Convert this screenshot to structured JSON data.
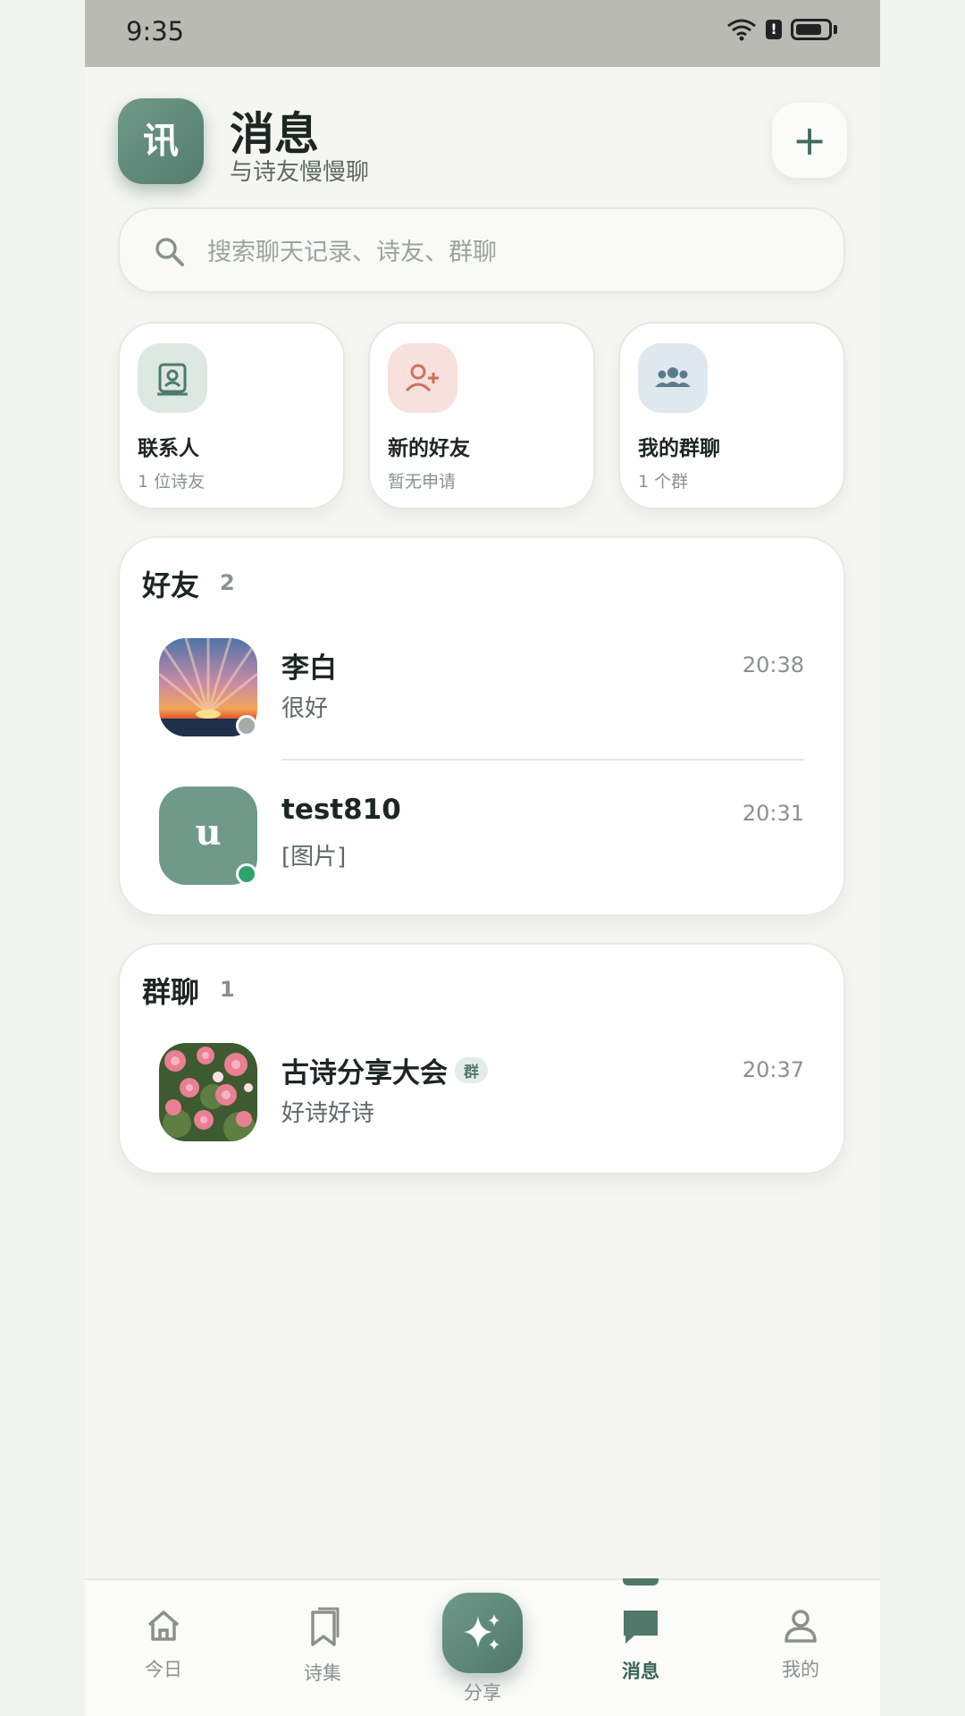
{
  "status_bar": {
    "time": "9:35"
  },
  "header": {
    "logo_text": "讯",
    "title": "消息",
    "subtitle": "与诗友慢慢聊",
    "add_symbol": "+"
  },
  "search": {
    "placeholder": "搜索聊天记录、诗友、群聊"
  },
  "quick_actions": [
    {
      "label": "联系人",
      "sub": "1 位诗友",
      "icon": "contact-book-icon",
      "bg": "#dde8e3",
      "color": "#4f7a6b"
    },
    {
      "label": "新的好友",
      "sub": "暂无申请",
      "icon": "add-user-icon",
      "bg": "#f8e1dc",
      "color": "#cf6f62"
    },
    {
      "label": "我的群聊",
      "sub": "1 个群",
      "icon": "group-icon",
      "bg": "#dfe8ee",
      "color": "#5c7a8d"
    }
  ],
  "friends": {
    "title": "好友",
    "count": "2",
    "items": [
      {
        "name": "李白",
        "message": "很好",
        "time": "20:38",
        "status_color": "#a7aca9"
      },
      {
        "name": "test810",
        "message": "[图片]",
        "time": "20:31",
        "avatar_letter": "u",
        "status_color": "#2fa36b"
      }
    ]
  },
  "groups": {
    "title": "群聊",
    "count": "1",
    "items": [
      {
        "name": "古诗分享大会",
        "tag": "群",
        "message": "好诗好诗",
        "time": "20:37"
      }
    ]
  },
  "tabbar": {
    "tabs": [
      {
        "label": "今日",
        "icon": "home-icon"
      },
      {
        "label": "诗集",
        "icon": "bookmark-icon"
      },
      {
        "label": "分享",
        "icon": "sparkle-icon"
      },
      {
        "label": "消息",
        "icon": "chat-icon",
        "active": true
      },
      {
        "label": "我的",
        "icon": "user-icon"
      }
    ]
  },
  "colors": {
    "accent": "#4f786a",
    "background": "#f5f6f2"
  }
}
